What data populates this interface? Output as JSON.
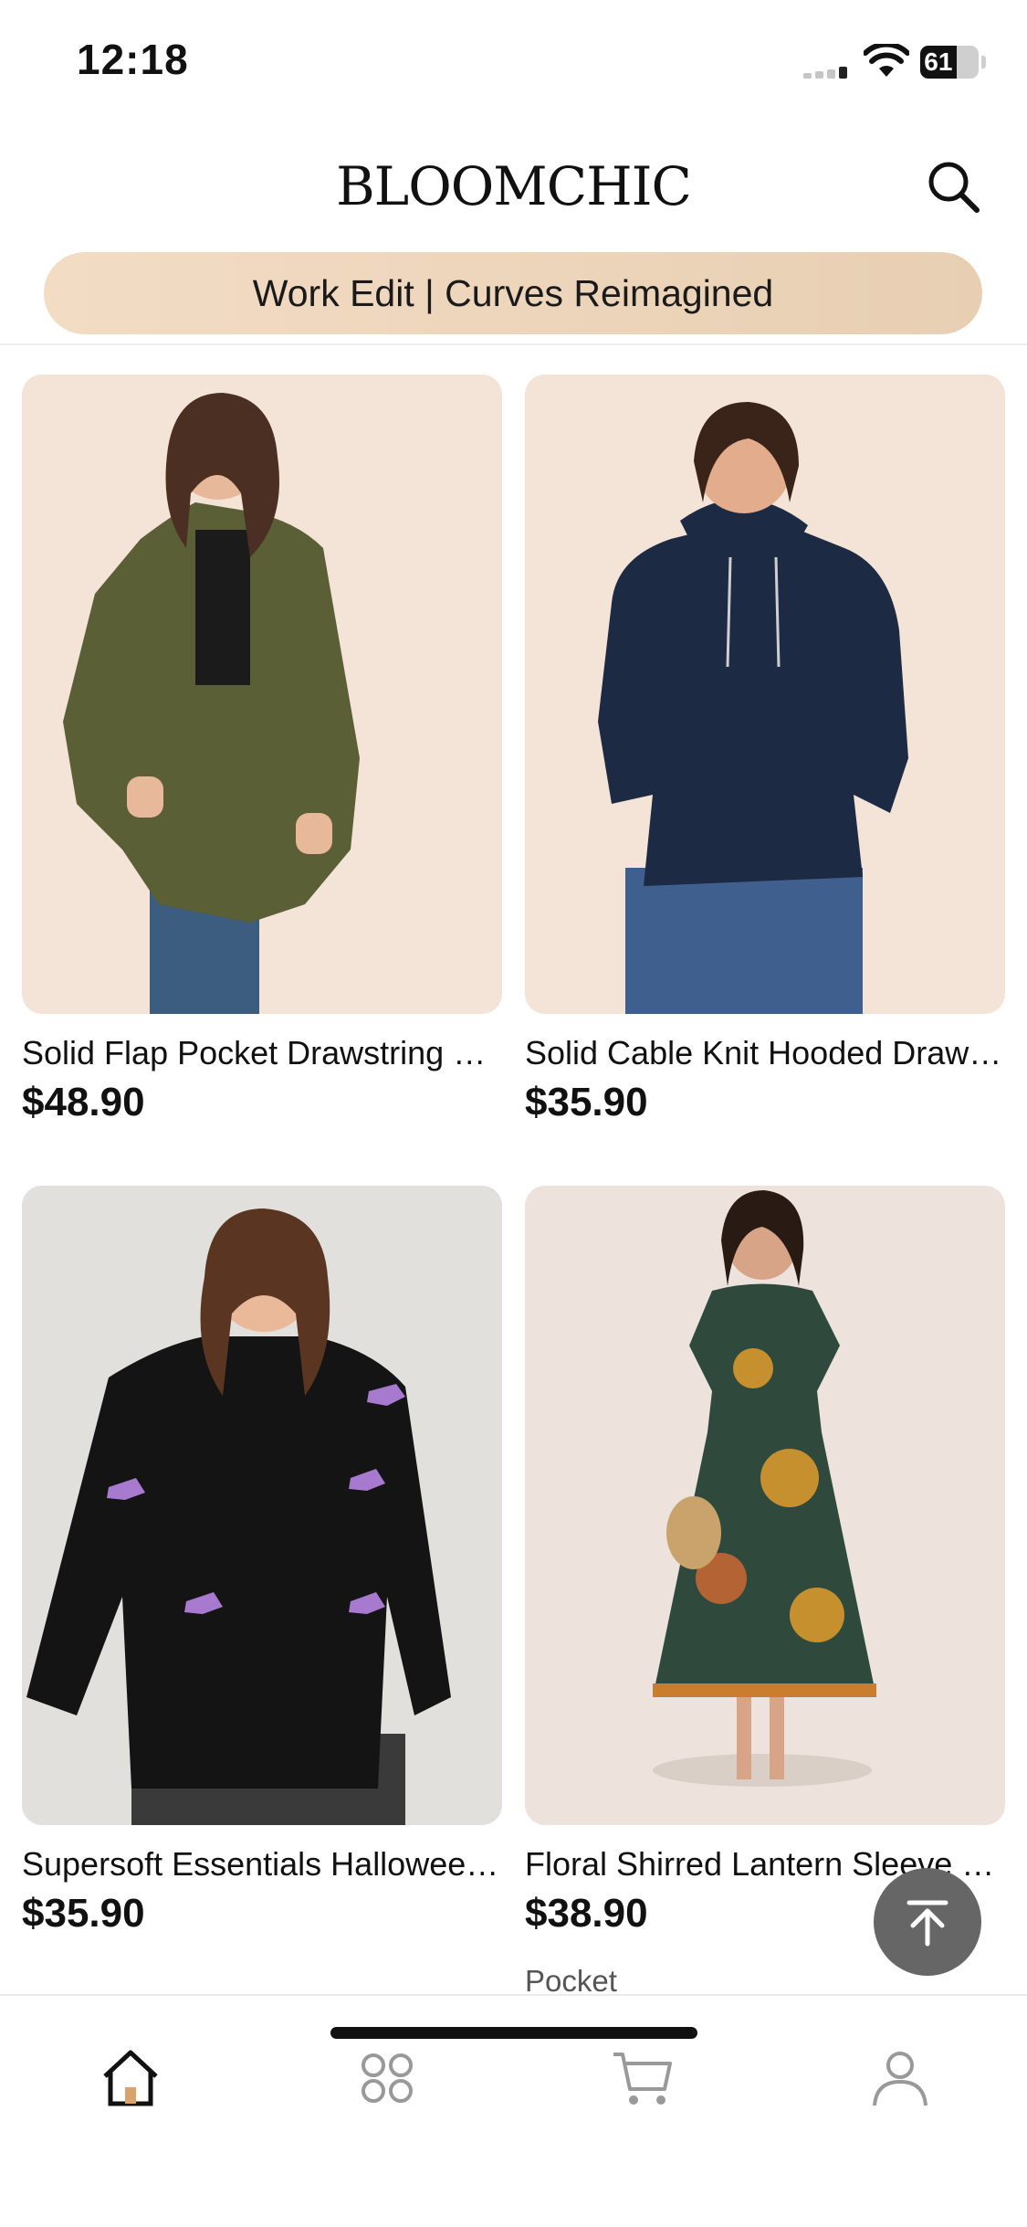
{
  "status_bar": {
    "time": "12:18",
    "battery": "61",
    "battery_level_percent": 61
  },
  "header": {
    "logo": "BLOOMCHIC",
    "search_icon": "search-icon"
  },
  "promo": {
    "text": "Work Edit | Curves Reimagined"
  },
  "products": [
    {
      "name": "Solid Flap Pocket Drawstring Utility Jacket",
      "price": "$48.90",
      "tag": ""
    },
    {
      "name": "Solid Cable Knit Hooded Drawstring Sweatshirt",
      "price": "$35.90",
      "tag": ""
    },
    {
      "name": "Supersoft Essentials Halloween Bat Cardigan",
      "price": "$35.90",
      "tag": ""
    },
    {
      "name": "Floral Shirred Lantern Sleeve Dress",
      "price": "$38.90",
      "tag": "Pocket"
    }
  ],
  "tab_bar": {
    "items": [
      "home-icon",
      "categories-icon",
      "cart-icon",
      "account-icon"
    ],
    "active": "home-icon"
  },
  "colors": {
    "banner_bg": "#eed6bc",
    "back_to_top_bg": "#666666",
    "card_bg_1": "#f4e3d7",
    "card_bg_3": "#e2e0dd"
  }
}
